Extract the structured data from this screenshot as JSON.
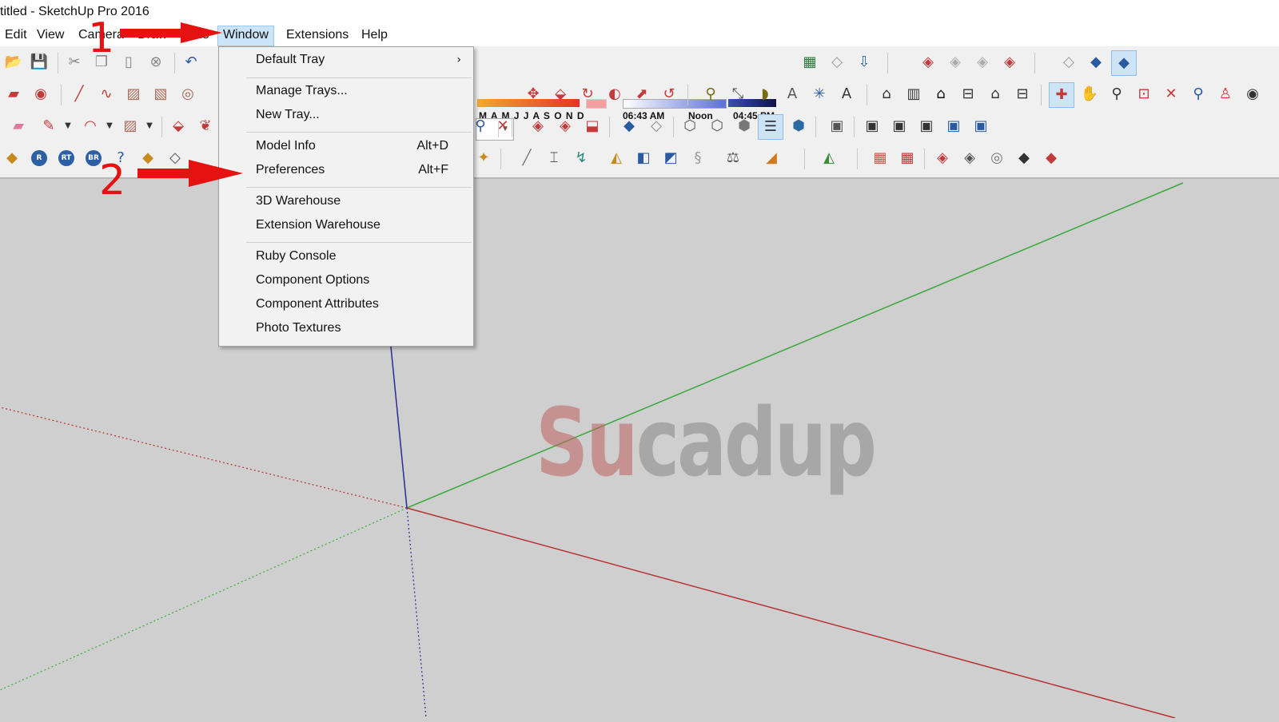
{
  "window": {
    "title": "titled - SketchUp Pro 2016"
  },
  "menubar": {
    "items": [
      {
        "label": "Edit"
      },
      {
        "label": "View"
      },
      {
        "label": "Camera"
      },
      {
        "label": "Draw"
      },
      {
        "label": "Tools"
      },
      {
        "label": "Window"
      },
      {
        "label": "Extensions"
      },
      {
        "label": "Help"
      }
    ]
  },
  "window_menu": {
    "items": [
      {
        "label": "Default Tray",
        "shortcut": "",
        "submenu": "›"
      },
      {
        "label": "Manage Trays...",
        "shortcut": ""
      },
      {
        "label": "New Tray...",
        "shortcut": ""
      },
      {
        "label": "Model Info",
        "shortcut": "Alt+D"
      },
      {
        "label": "Preferences",
        "shortcut": "Alt+F"
      },
      {
        "label": "3D Warehouse",
        "shortcut": ""
      },
      {
        "label": "Extension Warehouse",
        "shortcut": ""
      },
      {
        "label": "Ruby Console",
        "shortcut": ""
      },
      {
        "label": "Component Options",
        "shortcut": ""
      },
      {
        "label": "Component Attributes",
        "shortcut": ""
      },
      {
        "label": "Photo Textures",
        "shortcut": ""
      }
    ]
  },
  "shadows": {
    "months": "M A M J J A S O N D",
    "time_start": "06:43 AM",
    "time_mid": "Noon",
    "time_end": "04:45 PM"
  },
  "toolbar_row4_labels": {
    "r": "R",
    "rt": "RT",
    "br": "BR"
  },
  "annotations": {
    "step1": "1",
    "step2": "2",
    "color": "#e51212"
  },
  "watermark": {
    "part1": "Su",
    "part2": "cadup"
  },
  "axes": {
    "red": "#b83030",
    "green": "#3aa83a",
    "blue": "#2a2a9a"
  }
}
